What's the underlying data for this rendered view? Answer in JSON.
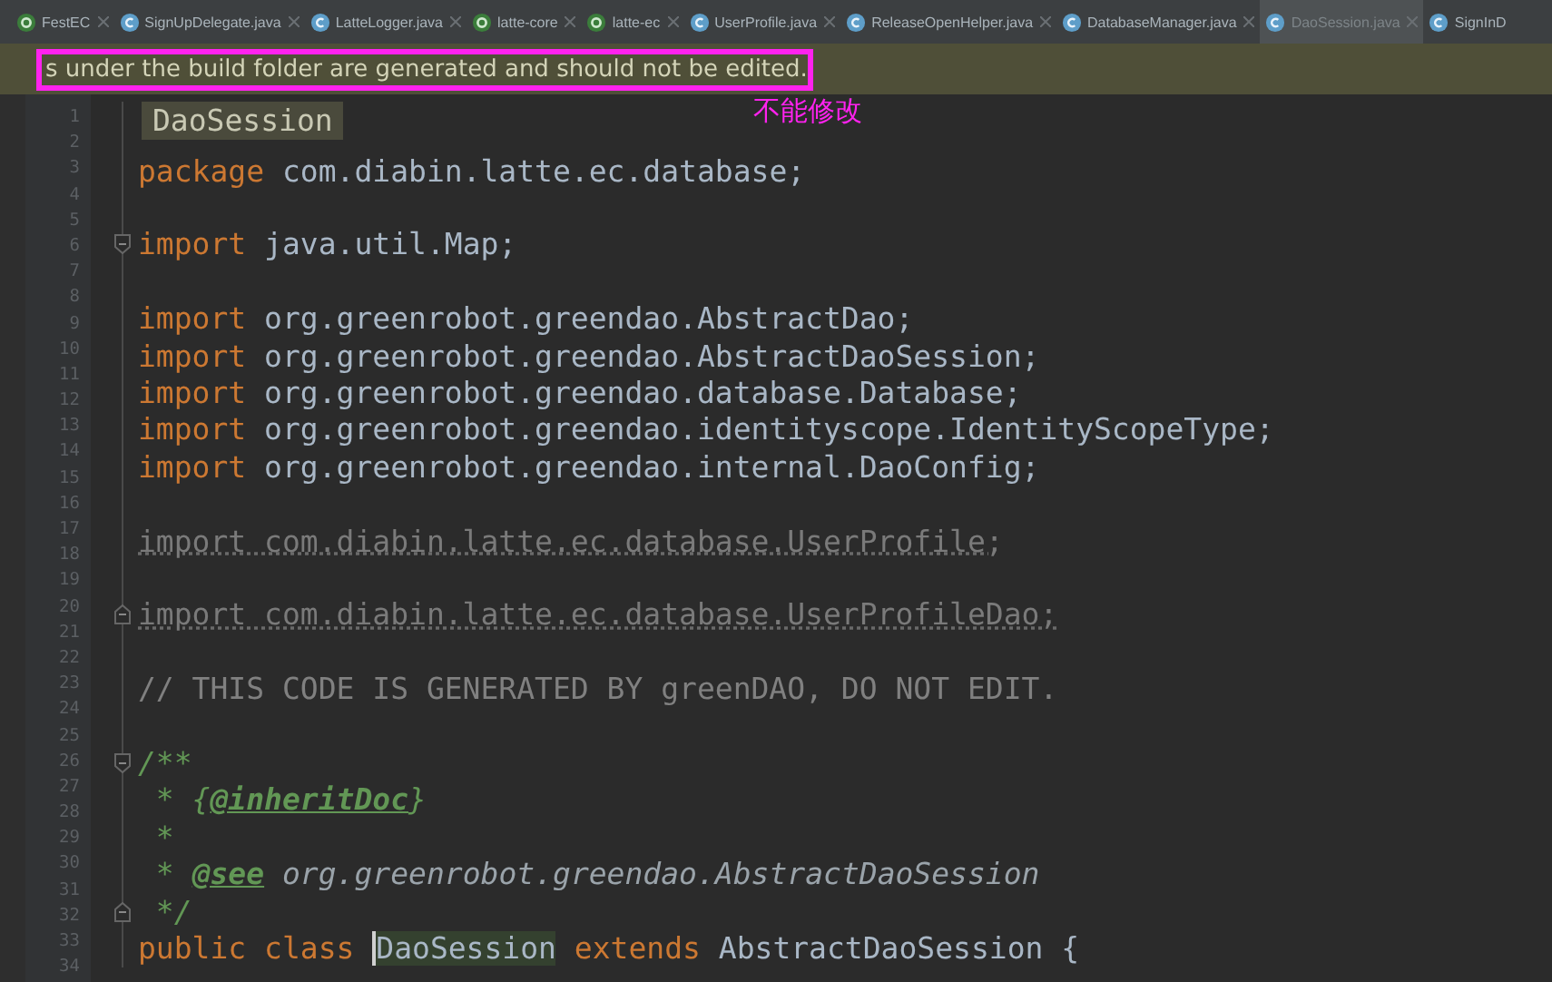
{
  "tabs": [
    {
      "label": "FestEC",
      "kind": "module",
      "selected": false
    },
    {
      "label": "SignUpDelegate.java",
      "kind": "class",
      "selected": false
    },
    {
      "label": "LatteLogger.java",
      "kind": "class",
      "selected": false
    },
    {
      "label": "latte-core",
      "kind": "module",
      "selected": false
    },
    {
      "label": "latte-ec",
      "kind": "module",
      "selected": false
    },
    {
      "label": "UserProfile.java",
      "kind": "class",
      "selected": false
    },
    {
      "label": "ReleaseOpenHelper.java",
      "kind": "class",
      "selected": false
    },
    {
      "label": "DatabaseManager.java",
      "kind": "class",
      "selected": false
    },
    {
      "label": "DaoSession.java",
      "kind": "class",
      "selected": true
    },
    {
      "label": "SignInD",
      "kind": "class",
      "selected": false
    }
  ],
  "banner": {
    "text": "s under the build folder are generated and should not be edited.",
    "annotation": "不能修改"
  },
  "editor": {
    "breadcrumb": "DaoSession",
    "line_numbers": [
      "1",
      "2",
      "3",
      "4",
      "5",
      "6",
      "7",
      "8",
      "9",
      "10",
      "11",
      "12",
      "13",
      "14",
      "15",
      "16",
      "17",
      "18",
      "19",
      "20",
      "21",
      "22",
      "23",
      "24",
      "25",
      "26",
      "27",
      "28",
      "29",
      "30",
      "31",
      "32",
      "33",
      "34"
    ],
    "lines": [
      {
        "kind": "code",
        "tokens": [
          {
            "kind": "keyword",
            "text": "package"
          },
          {
            "kind": "plain",
            "text": " com.diabin.latte.ec.database;"
          }
        ]
      },
      {
        "kind": "blank"
      },
      {
        "kind": "code",
        "fold_start": true,
        "tokens": [
          {
            "kind": "keyword",
            "text": "import"
          },
          {
            "kind": "plain",
            "text": " java.util.Map;"
          }
        ]
      },
      {
        "kind": "blank"
      },
      {
        "kind": "code",
        "tokens": [
          {
            "kind": "keyword",
            "text": "import"
          },
          {
            "kind": "plain",
            "text": " org.greenrobot.greendao.AbstractDao;"
          }
        ]
      },
      {
        "kind": "code",
        "tokens": [
          {
            "kind": "keyword",
            "text": "import"
          },
          {
            "kind": "plain",
            "text": " org.greenrobot.greendao.AbstractDaoSession;"
          }
        ]
      },
      {
        "kind": "code",
        "tokens": [
          {
            "kind": "keyword",
            "text": "import"
          },
          {
            "kind": "plain",
            "text": " org.greenrobot.greendao.database.Database;"
          }
        ]
      },
      {
        "kind": "code",
        "tokens": [
          {
            "kind": "keyword",
            "text": "import"
          },
          {
            "kind": "plain",
            "text": " org.greenrobot.greendao.identityscope.IdentityScopeType;"
          }
        ]
      },
      {
        "kind": "code",
        "tokens": [
          {
            "kind": "keyword",
            "text": "import"
          },
          {
            "kind": "plain",
            "text": " org.greenrobot.greendao.internal.DaoConfig;"
          }
        ]
      },
      {
        "kind": "blank"
      },
      {
        "kind": "code",
        "tokens": [
          {
            "kind": "unused",
            "text": "import com.diabin.latte.ec.database.UserProfile;"
          }
        ]
      },
      {
        "kind": "blank"
      },
      {
        "kind": "code",
        "fold_end": true,
        "tokens": [
          {
            "kind": "unused",
            "text": "import com.diabin.latte.ec.database.UserProfileDao;"
          }
        ]
      },
      {
        "kind": "blank"
      },
      {
        "kind": "code",
        "tokens": [
          {
            "kind": "comment",
            "text": "// THIS CODE IS GENERATED BY greenDAO, DO NOT EDIT."
          }
        ]
      },
      {
        "kind": "blank"
      },
      {
        "kind": "code",
        "fold_start": true,
        "tokens": [
          {
            "kind": "doc",
            "text": "/**"
          }
        ]
      },
      {
        "kind": "code",
        "tokens": [
          {
            "kind": "doc",
            "text": " * {"
          },
          {
            "kind": "doctag",
            "text": "@inheritDoc"
          },
          {
            "kind": "doc",
            "text": "}"
          }
        ]
      },
      {
        "kind": "code",
        "tokens": [
          {
            "kind": "doc",
            "text": " *"
          }
        ]
      },
      {
        "kind": "code",
        "tokens": [
          {
            "kind": "doc",
            "text": " * "
          },
          {
            "kind": "doctag",
            "text": "@see"
          },
          {
            "kind": "docref",
            "text": " org.greenrobot.greendao.AbstractDaoSession"
          }
        ]
      },
      {
        "kind": "code",
        "fold_end": true,
        "tokens": [
          {
            "kind": "doc",
            "text": " */"
          }
        ]
      },
      {
        "kind": "code",
        "tokens": [
          {
            "kind": "keyword",
            "text": "public class "
          },
          {
            "kind": "match",
            "text": "DaoSession",
            "cursor": true
          },
          {
            "kind": "keyword",
            "text": " extends "
          },
          {
            "kind": "plain",
            "text": "AbstractDaoSession {"
          }
        ]
      }
    ]
  }
}
